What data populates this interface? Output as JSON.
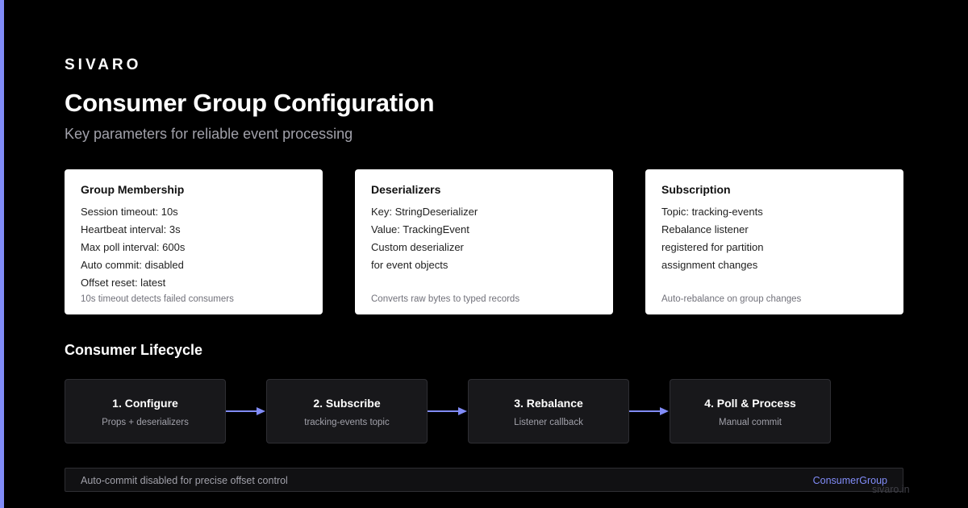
{
  "brand": "SIVARO",
  "title": "Consumer Group Configuration",
  "subtitle": "Key parameters for reliable event processing",
  "colors": {
    "accent": "#818cf8",
    "background": "#000000",
    "card": "#ffffff",
    "step_bg": "#18181b"
  },
  "cards": [
    {
      "title": "Group Membership",
      "lines": [
        "Session timeout: 10s",
        "Heartbeat interval: 3s",
        "Max poll interval: 600s",
        "Auto commit: disabled",
        "Offset reset: latest"
      ],
      "note": "10s timeout detects failed consumers"
    },
    {
      "title": "Deserializers",
      "lines": [
        "Key: StringDeserializer",
        "Value: TrackingEvent",
        "Custom deserializer",
        "for event objects"
      ],
      "note": "Converts raw bytes to typed records"
    },
    {
      "title": "Subscription",
      "lines": [
        "Topic: tracking-events",
        "Rebalance listener",
        "registered for partition",
        "assignment changes"
      ],
      "note": "Auto-rebalance on group changes"
    }
  ],
  "lifecycle": {
    "title": "Consumer Lifecycle",
    "steps": [
      {
        "title": "1. Configure",
        "desc": "Props + deserializers"
      },
      {
        "title": "2. Subscribe",
        "desc": "tracking-events topic"
      },
      {
        "title": "3. Rebalance",
        "desc": "Listener callback"
      },
      {
        "title": "4. Poll & Process",
        "desc": "Manual commit"
      }
    ]
  },
  "footer": {
    "text": "Auto-commit disabled for precise offset control",
    "tag": "ConsumerGroup"
  },
  "watermark": "sivaro.in"
}
